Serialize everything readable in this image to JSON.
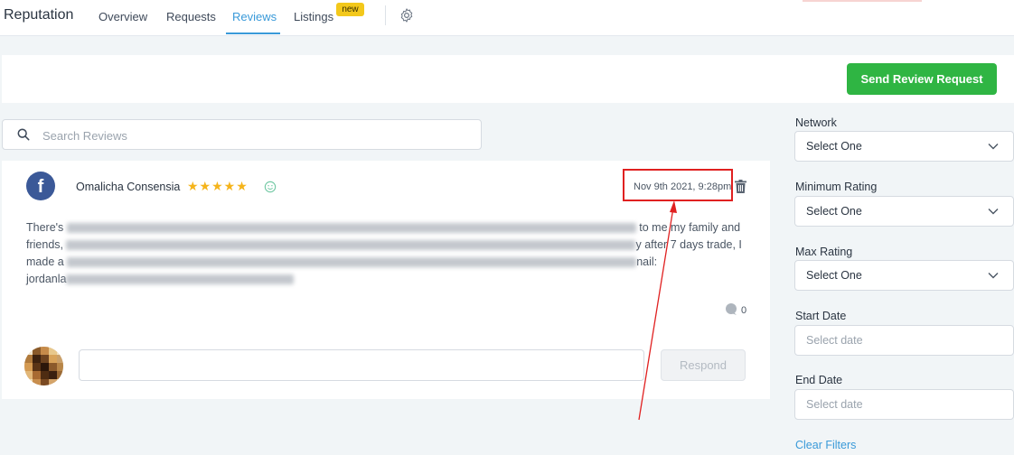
{
  "app": {
    "title": "Reputation",
    "tabs": [
      {
        "label": "Overview"
      },
      {
        "label": "Requests"
      },
      {
        "label": "Reviews"
      },
      {
        "label": "Listings",
        "badge": "new"
      }
    ],
    "active_tab": "Reviews",
    "accent_color": "#3a9ad9"
  },
  "actions": {
    "send_review_request": "Send Review Request",
    "button_color": "#2fb543"
  },
  "search": {
    "placeholder": "Search Reviews"
  },
  "review": {
    "network_icon": "facebook-icon",
    "reviewer_name": "Omalicha Consensia",
    "stars": "★★★★★",
    "sentiment_icon": "smile-icon",
    "date": "Nov 9th 2021, 9:28pm",
    "text": {
      "line1_start": "There's",
      "line1_end": "to me my family and",
      "line2_start": "friends,",
      "line2_end": "y after 7 days trade, I",
      "line3_start": "made a",
      "line3_end": "nail:",
      "line4_start": "jordanla"
    },
    "comment_count": "0",
    "respond_label": "Respond"
  },
  "filters": {
    "network": {
      "label": "Network",
      "value": "Select One"
    },
    "min_rating": {
      "label": "Minimum Rating",
      "value": "Select One"
    },
    "max_rating": {
      "label": "Max Rating",
      "value": "Select One"
    },
    "start_date": {
      "label": "Start Date",
      "placeholder": "Select date"
    },
    "end_date": {
      "label": "End Date",
      "placeholder": "Select date"
    },
    "clear": "Clear Filters"
  }
}
